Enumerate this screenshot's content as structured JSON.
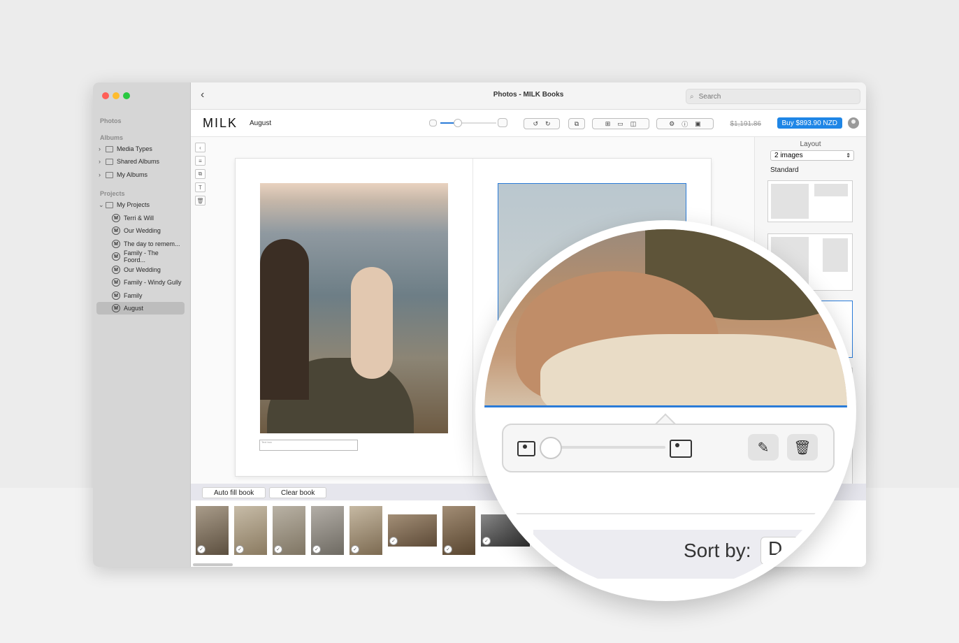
{
  "window": {
    "title": "Photos - MILK Books"
  },
  "search": {
    "placeholder": "Search"
  },
  "sidebar": {
    "photos_label": "Photos",
    "albums_label": "Albums",
    "albums": [
      {
        "label": "Media Types"
      },
      {
        "label": "Shared Albums"
      },
      {
        "label": "My Albums"
      }
    ],
    "projects_label": "Projects",
    "my_projects": "My Projects",
    "projects": [
      {
        "label": "Terri & Will",
        "badge": "M"
      },
      {
        "label": "Our Wedding",
        "badge": "M"
      },
      {
        "label": "The day to remem...",
        "badge": "M"
      },
      {
        "label": "Family - The Foord...",
        "badge": "M"
      },
      {
        "label": "Our Wedding",
        "badge": "M"
      },
      {
        "label": "Family - Windy Gully",
        "badge": "M"
      },
      {
        "label": "Family",
        "badge": "M"
      },
      {
        "label": "August",
        "badge": "M"
      }
    ]
  },
  "toolbar": {
    "logo": "MILK",
    "project_name": "August",
    "old_price": "$1,191.86",
    "buy_label": "Buy $893.90 NZD",
    "zoom_level": 0.3
  },
  "page": {
    "textbox_placeholder": "Text box"
  },
  "layout_panel": {
    "title": "Layout",
    "select_value": "2 images",
    "section_label": "Standard"
  },
  "strip": {
    "auto_fill": "Auto fill book",
    "clear_book": "Clear book"
  },
  "magnifier": {
    "sort_label": "Sort by:",
    "sort_value": "D"
  },
  "colors": {
    "accent": "#1f86e6",
    "selection": "#2a7bd8",
    "traffic_red": "#ff5f57",
    "traffic_yellow": "#febc2e",
    "traffic_green": "#28c840"
  }
}
